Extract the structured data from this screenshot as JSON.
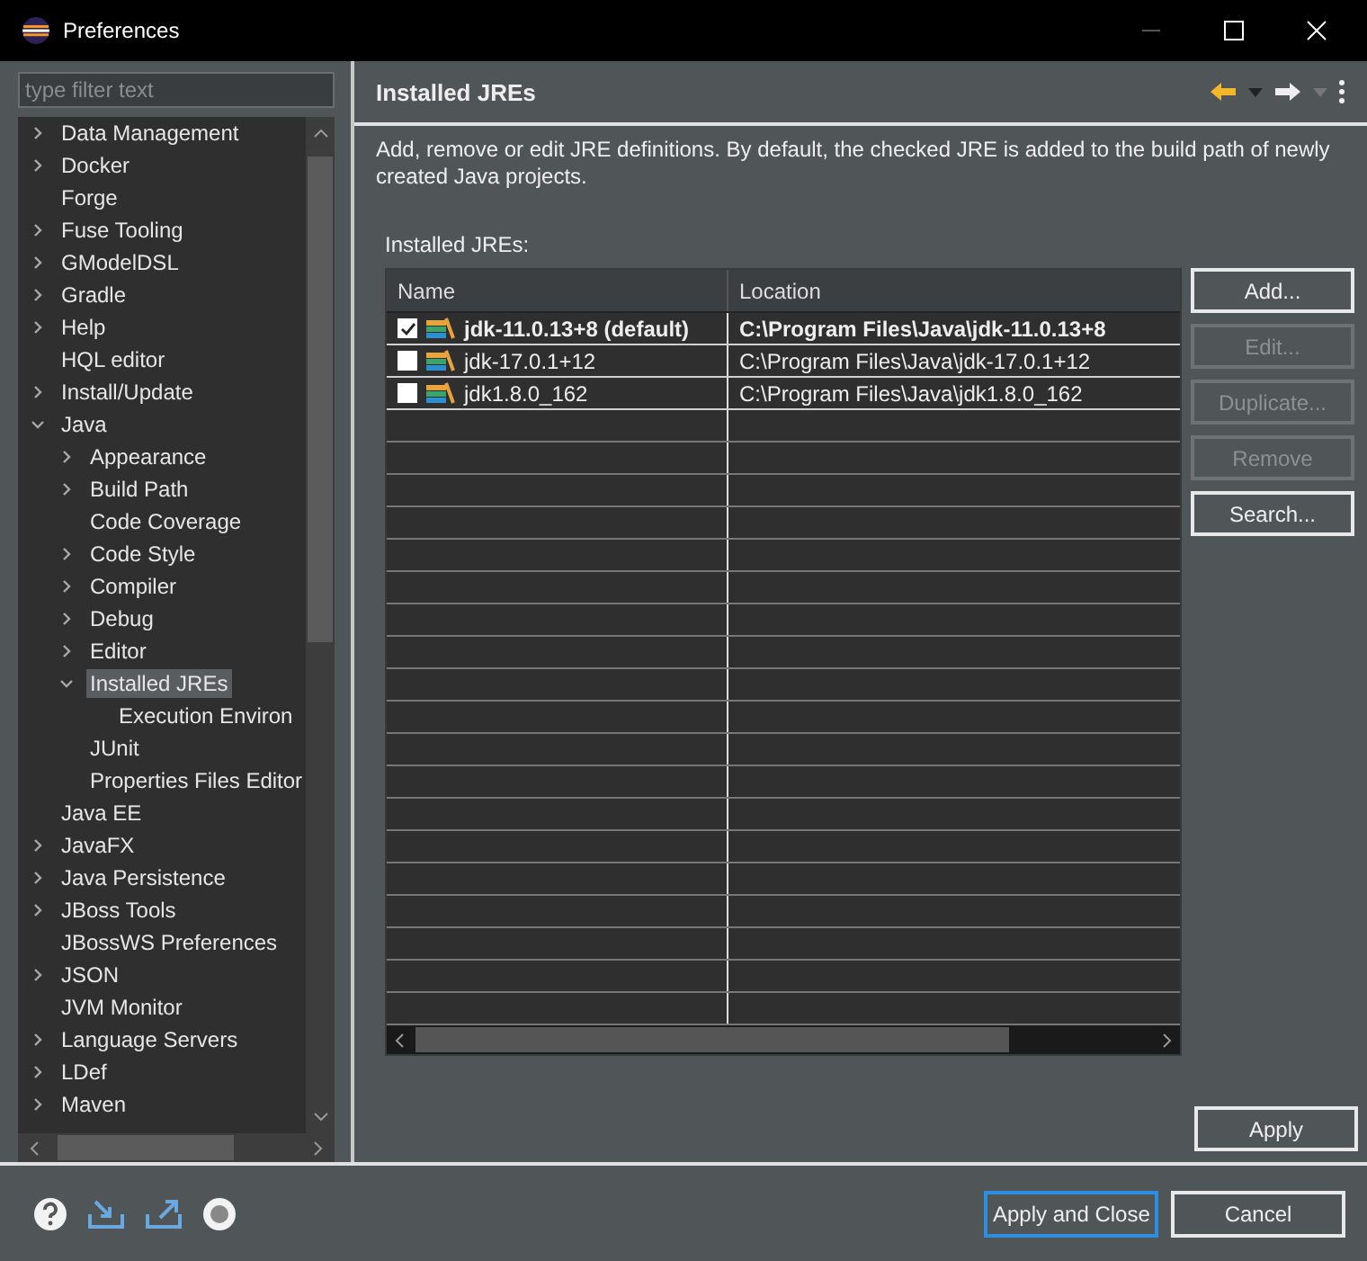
{
  "window": {
    "title": "Preferences"
  },
  "filter": {
    "placeholder": "type filter text"
  },
  "tree": [
    {
      "label": "Data Management",
      "kind": "folder",
      "expanded": false,
      "selected": false
    },
    {
      "label": "Docker",
      "kind": "folder",
      "expanded": false,
      "selected": false
    },
    {
      "label": "Forge",
      "kind": "leaf",
      "selected": false
    },
    {
      "label": "Fuse Tooling",
      "kind": "folder",
      "expanded": false,
      "selected": false
    },
    {
      "label": "GModelDSL",
      "kind": "folder",
      "expanded": false,
      "selected": false
    },
    {
      "label": "Gradle",
      "kind": "folder",
      "expanded": false,
      "selected": false
    },
    {
      "label": "Help",
      "kind": "folder",
      "expanded": false,
      "selected": false
    },
    {
      "label": "HQL editor",
      "kind": "leaf",
      "selected": false
    },
    {
      "label": "Install/Update",
      "kind": "folder",
      "expanded": false,
      "selected": false
    },
    {
      "label": "Java",
      "kind": "folder",
      "expanded": true,
      "selected": false,
      "children": [
        {
          "label": "Appearance",
          "kind": "folder",
          "expanded": false,
          "selected": false
        },
        {
          "label": "Build Path",
          "kind": "folder",
          "expanded": false,
          "selected": false
        },
        {
          "label": "Code Coverage",
          "kind": "leaf",
          "selected": false
        },
        {
          "label": "Code Style",
          "kind": "folder",
          "expanded": false,
          "selected": false
        },
        {
          "label": "Compiler",
          "kind": "folder",
          "expanded": false,
          "selected": false
        },
        {
          "label": "Debug",
          "kind": "folder",
          "expanded": false,
          "selected": false
        },
        {
          "label": "Editor",
          "kind": "folder",
          "expanded": false,
          "selected": false
        },
        {
          "label": "Installed JREs",
          "kind": "folder",
          "expanded": true,
          "selected": true,
          "children": [
            {
              "label": "Execution Environ",
              "kind": "leaf",
              "selected": false
            }
          ]
        },
        {
          "label": "JUnit",
          "kind": "leaf",
          "selected": false
        },
        {
          "label": "Properties Files Editor",
          "kind": "leaf",
          "selected": false
        }
      ]
    },
    {
      "label": "Java EE",
      "kind": "leaf",
      "selected": false
    },
    {
      "label": "JavaFX",
      "kind": "folder",
      "expanded": false,
      "selected": false
    },
    {
      "label": "Java Persistence",
      "kind": "folder",
      "expanded": false,
      "selected": false
    },
    {
      "label": "JBoss Tools",
      "kind": "folder",
      "expanded": false,
      "selected": false
    },
    {
      "label": "JBossWS Preferences",
      "kind": "leaf",
      "selected": false
    },
    {
      "label": "JSON",
      "kind": "folder",
      "expanded": false,
      "selected": false
    },
    {
      "label": "JVM Monitor",
      "kind": "leaf",
      "selected": false
    },
    {
      "label": "Language Servers",
      "kind": "folder",
      "expanded": false,
      "selected": false
    },
    {
      "label": "LDef",
      "kind": "folder",
      "expanded": false,
      "selected": false
    },
    {
      "label": "Maven",
      "kind": "folder",
      "expanded": false,
      "selected": false
    }
  ],
  "page": {
    "title": "Installed JREs",
    "description": "Add, remove or edit JRE definitions. By default, the checked JRE is added to the build path of newly created Java projects.",
    "table_label": "Installed JREs:"
  },
  "table": {
    "columns": [
      "Name",
      "Location"
    ],
    "rows": [
      {
        "name": "jdk-11.0.13+8 (default)",
        "location": "C:\\Program Files\\Java\\jdk-11.0.13+8",
        "checked": true,
        "default": true
      },
      {
        "name": "jdk-17.0.1+12",
        "location": "C:\\Program Files\\Java\\jdk-17.0.1+12",
        "checked": false,
        "default": false
      },
      {
        "name": "jdk1.8.0_162",
        "location": "C:\\Program Files\\Java\\jdk1.8.0_162",
        "checked": false,
        "default": false
      }
    ]
  },
  "side_buttons": [
    {
      "label": "Add...",
      "disabled": false
    },
    {
      "label": "Edit...",
      "disabled": true
    },
    {
      "label": "Duplicate...",
      "disabled": true
    },
    {
      "label": "Remove",
      "disabled": true
    },
    {
      "label": "Search...",
      "disabled": false
    }
  ],
  "apply_button": "Apply",
  "footer_buttons": [
    {
      "label": "Apply and Close",
      "selected": true
    },
    {
      "label": "Cancel",
      "selected": false
    }
  ]
}
